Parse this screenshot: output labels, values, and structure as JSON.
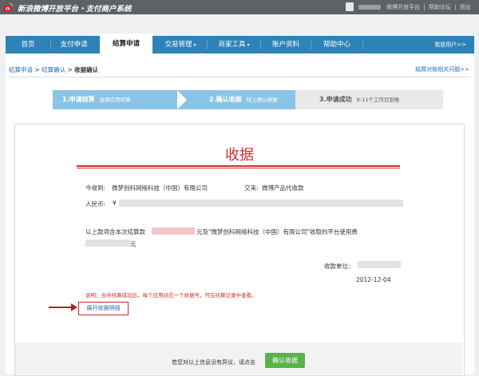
{
  "header": {
    "brand_title": "新浪微博开放平台・支付商户系统",
    "links": [
      "微博开放平台",
      "|",
      "帮助论坛",
      "|",
      "退出"
    ]
  },
  "nav": {
    "items": [
      {
        "label": "首页"
      },
      {
        "label": "支付申请"
      },
      {
        "label": "结算申请",
        "active": true
      },
      {
        "label": "交易管理",
        "dropdown": true
      },
      {
        "label": "商家工具",
        "dropdown": true
      },
      {
        "label": "账户资料"
      },
      {
        "label": "帮助中心"
      }
    ],
    "help_link": "我是用户>>"
  },
  "breadcrumb": {
    "items": [
      "结算申请",
      "结算确认"
    ],
    "separator": ">",
    "current": "收据确认"
  },
  "faq_link": "结算对账相关问题>>",
  "steps": [
    {
      "title": "1.申请结算",
      "desc": "选择应用结算"
    },
    {
      "title": "2.确认收据",
      "desc": "线上确认收据"
    },
    {
      "title": "3.申请成功",
      "desc": "9-11个工作日到账"
    }
  ],
  "receipt": {
    "title": "收据",
    "received_from_label": "今收到:",
    "received_from": "微梦创科网络科技（中国）有限公司",
    "paid_for_label": "交来:",
    "paid_for": "微博产品代收款",
    "amount_label": "人民币:",
    "currency_symbol": "¥",
    "content_prefix": "以上款项含本次结算款",
    "content_mid": "元及\"微梦创科网络科技（中国）有限公司\"收取的平台使用费",
    "content_suffix": "元",
    "unit_label": "收款单位:",
    "date": "2012-12-04",
    "note": "说明：合并结算成功后，每个应用对应一个收据号，可在结算记录中查看。",
    "expand_link": "展开收据明细"
  },
  "footer": {
    "prompt": "若您对以上信息没有异议，请点击",
    "confirm_button": "确认收据"
  },
  "colors": {
    "top_bar": "#5d6268",
    "nav_blue": "#2d82b6",
    "step_active": "#8ac4e6",
    "receipt_red": "#d42b2b",
    "confirm_green": "#5ab34a"
  }
}
